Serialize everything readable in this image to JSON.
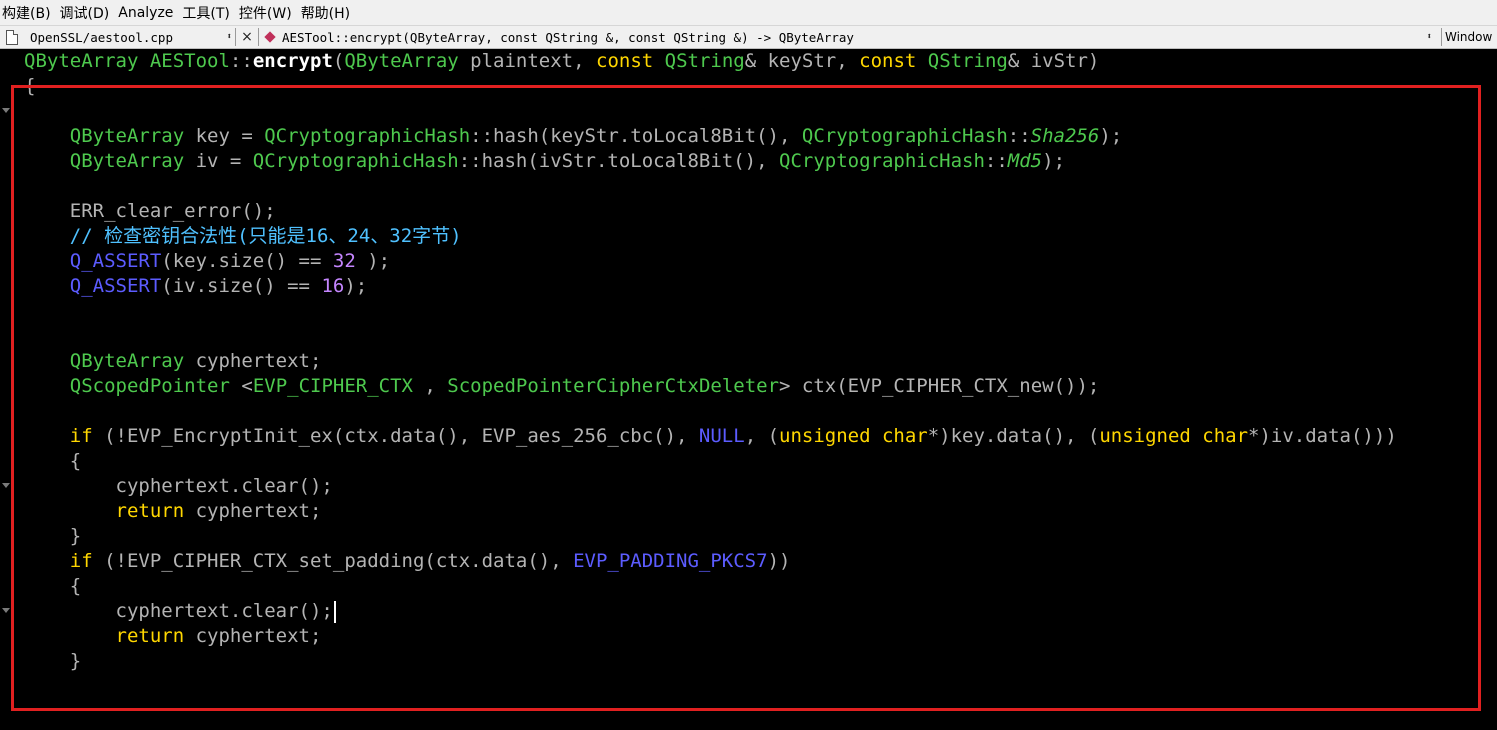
{
  "menu": [
    "构建(B)",
    "调试(D)",
    "Analyze",
    "工具(T)",
    "控件(W)",
    "帮助(H)"
  ],
  "nav": {
    "file": "OpenSSL/aestool.cpp",
    "updown": "⬍",
    "close": "×",
    "function": "AESTool::encrypt(QByteArray, const QString &, const QString &) -> QByteArray",
    "window": "Window"
  },
  "code_lines": [
    [
      [
        "t",
        "QByteArray "
      ],
      [
        "t",
        "AESTool"
      ],
      [
        "p",
        "::"
      ],
      [
        "fb",
        "encrypt"
      ],
      [
        "p",
        "("
      ],
      [
        "t",
        "QByteArray"
      ],
      [
        "p",
        " plaintext, "
      ],
      [
        "k",
        "const "
      ],
      [
        "t",
        "QString"
      ],
      [
        "p",
        "& keyStr, "
      ],
      [
        "k",
        "const "
      ],
      [
        "t",
        "QString"
      ],
      [
        "p",
        "& ivStr)"
      ]
    ],
    [
      [
        "p",
        "{"
      ]
    ],
    [],
    [
      [
        "p",
        "    "
      ],
      [
        "t",
        "QByteArray"
      ],
      [
        "p",
        " key = "
      ],
      [
        "t",
        "QCryptographicHash"
      ],
      [
        "p",
        "::hash(keyStr.toLocal8Bit(), "
      ],
      [
        "t",
        "QCryptographicHash"
      ],
      [
        "p",
        "::"
      ],
      [
        "e",
        "Sha256"
      ],
      [
        "p",
        ");"
      ]
    ],
    [
      [
        "p",
        "    "
      ],
      [
        "t",
        "QByteArray"
      ],
      [
        "p",
        " iv = "
      ],
      [
        "t",
        "QCryptographicHash"
      ],
      [
        "p",
        "::hash(ivStr.toLocal8Bit(), "
      ],
      [
        "t",
        "QCryptographicHash"
      ],
      [
        "p",
        "::"
      ],
      [
        "e",
        "Md5"
      ],
      [
        "p",
        ");"
      ]
    ],
    [],
    [
      [
        "p",
        "    ERR_clear_error();"
      ]
    ],
    [
      [
        "p",
        "    "
      ],
      [
        "c",
        "// 检查密钥合法性(只能是16、24、32字节)"
      ]
    ],
    [
      [
        "p",
        "    "
      ],
      [
        "m",
        "Q_ASSERT"
      ],
      [
        "p",
        "(key.size() == "
      ],
      [
        "n",
        "32"
      ],
      [
        "p",
        " );"
      ]
    ],
    [
      [
        "p",
        "    "
      ],
      [
        "m",
        "Q_ASSERT"
      ],
      [
        "p",
        "(iv.size() == "
      ],
      [
        "n",
        "16"
      ],
      [
        "p",
        ");"
      ]
    ],
    [],
    [],
    [
      [
        "p",
        "    "
      ],
      [
        "t",
        "QByteArray"
      ],
      [
        "p",
        " cyphertext;"
      ]
    ],
    [
      [
        "p",
        "    "
      ],
      [
        "t",
        "QScopedPointer"
      ],
      [
        "p",
        " <"
      ],
      [
        "t",
        "EVP_CIPHER_CTX"
      ],
      [
        "p",
        " , "
      ],
      [
        "t",
        "ScopedPointerCipherCtxDeleter"
      ],
      [
        "p",
        "> ctx(EVP_CIPHER_CTX_new());"
      ]
    ],
    [],
    [
      [
        "p",
        "    "
      ],
      [
        "k",
        "if"
      ],
      [
        "p",
        " (!EVP_EncryptInit_ex(ctx.data(), EVP_aes_256_cbc(), "
      ],
      [
        "m",
        "NULL"
      ],
      [
        "p",
        ", ("
      ],
      [
        "k",
        "unsigned char"
      ],
      [
        "p",
        "*)key.data(), ("
      ],
      [
        "k",
        "unsigned char"
      ],
      [
        "p",
        "*)iv.data()))"
      ]
    ],
    [
      [
        "p",
        "    {"
      ]
    ],
    [
      [
        "p",
        "        cyphertext.clear();"
      ]
    ],
    [
      [
        "p",
        "        "
      ],
      [
        "k",
        "return"
      ],
      [
        "p",
        " cyphertext;"
      ]
    ],
    [
      [
        "p",
        "    }"
      ]
    ],
    [
      [
        "p",
        "    "
      ],
      [
        "k",
        "if"
      ],
      [
        "p",
        " (!EVP_CIPHER_CTX_set_padding(ctx.data(), "
      ],
      [
        "m",
        "EVP_PADDING_PKCS7"
      ],
      [
        "p",
        "))"
      ]
    ],
    [
      [
        "p",
        "    {"
      ]
    ],
    [
      [
        "p",
        "        cyphertext.clear();"
      ],
      [
        "caret",
        ""
      ]
    ],
    [
      [
        "p",
        "        "
      ],
      [
        "k",
        "return"
      ],
      [
        "p",
        " cyphertext;"
      ]
    ],
    [
      [
        "p",
        "    }"
      ]
    ]
  ]
}
